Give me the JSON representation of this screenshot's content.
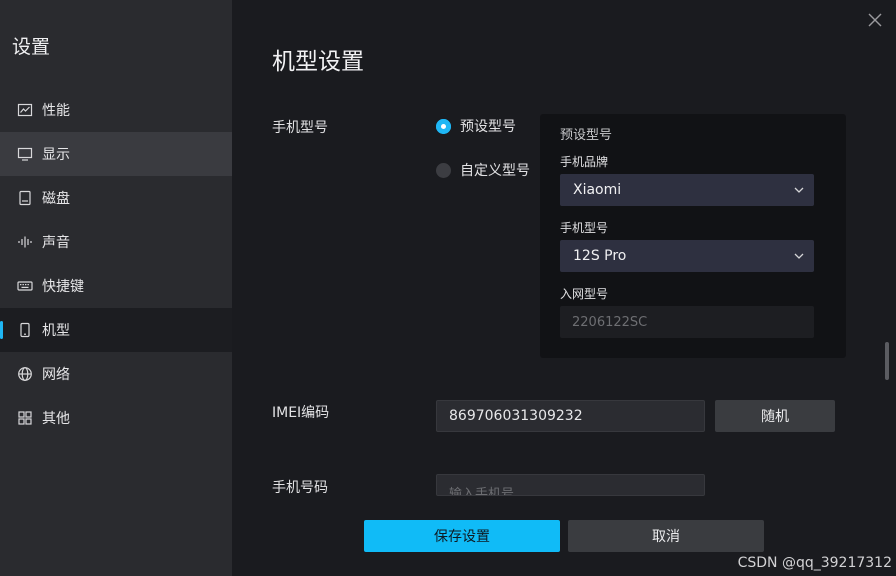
{
  "sidebar": {
    "title": "设置",
    "items": [
      {
        "label": "性能",
        "icon": "chart-line-icon"
      },
      {
        "label": "显示",
        "icon": "monitor-icon"
      },
      {
        "label": "磁盘",
        "icon": "disk-icon"
      },
      {
        "label": "声音",
        "icon": "sound-wave-icon"
      },
      {
        "label": "快捷键",
        "icon": "keyboard-icon"
      },
      {
        "label": "机型",
        "icon": "phone-icon"
      },
      {
        "label": "网络",
        "icon": "globe-icon"
      },
      {
        "label": "其他",
        "icon": "grid-icon"
      }
    ],
    "hover_item": "显示",
    "active_item": "机型"
  },
  "main": {
    "title": "机型设置",
    "model": {
      "label": "手机型号",
      "option_preset": "预设型号",
      "option_custom": "自定义型号",
      "selected": "预设型号",
      "panel": {
        "heading": "预设型号",
        "brand_label": "手机品牌",
        "brand_value": "Xiaomi",
        "model_label": "手机型号",
        "model_value": "12S Pro",
        "network_label": "入网型号",
        "network_value": "2206122SC"
      }
    },
    "imei": {
      "label": "IMEI编码",
      "value": "869706031309232",
      "random_button": "随机"
    },
    "phone": {
      "label": "手机号码",
      "placeholder": "输入手机号"
    },
    "footer": {
      "save": "保存设置",
      "cancel": "取消"
    }
  },
  "watermark": "CSDN @qq_39217312",
  "colors": {
    "accent": "#1fb7f5",
    "sidebar_bg": "#2a2b2f",
    "main_bg": "#1a1b1f",
    "primary_button": "#10bbf7"
  }
}
